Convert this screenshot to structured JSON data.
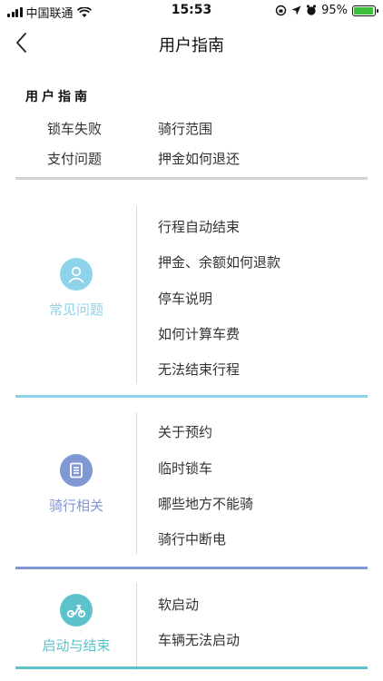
{
  "status": {
    "carrier": "中国联通",
    "time": "15:53",
    "battery": "95%",
    "battery_level": 0.95
  },
  "header": {
    "title": "用户指南"
  },
  "guide": {
    "title": "用户指南",
    "items": [
      "锁车失败",
      "骑行范围",
      "支付问题",
      "押金如何退还"
    ]
  },
  "sections": [
    {
      "label": "常见问题",
      "color": "#8fd3ea",
      "icon": "user-icon",
      "items": [
        "行程自动结束",
        "押金、余额如何退款",
        "停车说明",
        "如何计算车费",
        "无法结束行程"
      ]
    },
    {
      "label": "骑行相关",
      "color": "#7f97d3",
      "icon": "document-icon",
      "items": [
        "关于预约",
        "临时锁车",
        "哪些地方不能骑",
        "骑行中断电"
      ]
    },
    {
      "label": "启动与结束",
      "color": "#5cc3cc",
      "icon": "scooter-icon",
      "items": [
        "软启动",
        "车辆无法启动"
      ]
    }
  ]
}
